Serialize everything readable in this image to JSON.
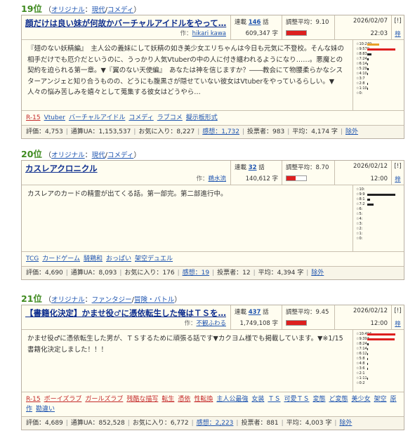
{
  "entries": [
    {
      "rank": "19位",
      "genre_main": "オリジナル",
      "genre_sub": "現代",
      "genre_type": "コメディ",
      "title": "顔だけは良い妹が何故かバーチャルアイドルをやって…",
      "author_label": "作：",
      "author": "hikari kawa",
      "serial_label": "連載",
      "episodes": "146",
      "episodes_unit": "話",
      "chars": "609,347 字",
      "rating_label": "調整平均：9.10",
      "rating_fill": 1.0,
      "date": "2026/02/07",
      "time": "22:03",
      "flag": "[!]",
      "pen": "梓",
      "description": "『翅のない妖精編』　主人公の義妹にして妖精の如き美少女エリちゃんは今日も元気に不登校。そんな妹の相手だけでも厄介だというのに、うっかり人気Vtuberの中の人に付き纏われるようになり……。悪魔との契約を迫られる第一章。▼『翼のない天使編』　あなたは神を信じますか？――教会にて物腰柔らかなシスターアンジェと知り合うものの、どうにも腹黒さが隠せていない彼女はVtuberをやっているらしい。▼人々の悩み苦しみを嬉々として蒐集する彼女はどうやら…",
      "tags": [
        {
          "text": "R-15",
          "class": "r"
        },
        {
          "text": "Vtuber",
          "class": "n"
        },
        {
          "text": "バーチャルアイドル",
          "class": "n"
        },
        {
          "text": "コメディ",
          "class": "n"
        },
        {
          "text": "ラブコメ",
          "class": "n"
        },
        {
          "text": "擬示板形式",
          "class": "n"
        }
      ],
      "graph": [
        {
          "label": "☆10:249",
          "value": 249,
          "color": "#e8a02a"
        },
        {
          "label": "☆9:570",
          "value": 570,
          "color": "#dd1f1f"
        },
        {
          "label": "☆8:83",
          "value": 83,
          "color": "#222"
        },
        {
          "label": "☆7:24",
          "value": 24,
          "color": "#222"
        },
        {
          "label": "☆6:14",
          "value": 14,
          "color": "#222"
        },
        {
          "label": "☆5:29",
          "value": 29,
          "color": "#222"
        },
        {
          "label": "☆4:10",
          "value": 10,
          "color": "#222"
        },
        {
          "label": "☆3:7",
          "value": 7,
          "color": "#222"
        },
        {
          "label": "☆2:8",
          "value": 8,
          "color": "#222"
        },
        {
          "label": "☆1:10",
          "value": 10,
          "color": "#222"
        },
        {
          "label": "☆0:",
          "value": 0,
          "color": "#222"
        }
      ],
      "stats": {
        "rating": "評価：4,753",
        "ua": "通算UA：1,153,537",
        "fav": "お気に入り：8,227",
        "review": "感想：1,732",
        "voters": "投票者：983",
        "avg": "平均：4,174 字",
        "exclude": "除外"
      }
    },
    {
      "rank": "20位",
      "genre_main": "オリジナル",
      "genre_sub": "現代",
      "genre_type": "コメディ",
      "title": "カスレアクロニクル",
      "author_label": "作：",
      "author": "鵜水流",
      "serial_label": "連載",
      "episodes": "32",
      "episodes_unit": "話",
      "chars": "140,612 字",
      "rating_label": "調整平均：8.70",
      "rating_fill": 0.45,
      "date": "2026/02/12",
      "time": "12:00",
      "flag": "[!]",
      "pen": "梓",
      "description": "カスレアのカードの精霊が出てくる話。第一部完。第二部進行中。",
      "tags": [
        {
          "text": "TCG",
          "class": "n"
        },
        {
          "text": "カードゲーム",
          "class": "n"
        },
        {
          "text": "騎鶏和",
          "class": "n"
        },
        {
          "text": "おっぱい",
          "class": "n"
        },
        {
          "text": "架空デュエル",
          "class": "n"
        }
      ],
      "graph": [
        {
          "label": "☆10:",
          "value": 0,
          "color": "#222"
        },
        {
          "label": "☆9:9",
          "value": 9,
          "color": "#222"
        },
        {
          "label": "☆8:1",
          "value": 1,
          "color": "#222"
        },
        {
          "label": "☆7:2",
          "value": 2,
          "color": "#222"
        },
        {
          "label": "☆6:",
          "value": 0,
          "color": "#222"
        },
        {
          "label": "☆5:",
          "value": 0,
          "color": "#222"
        },
        {
          "label": "☆4:",
          "value": 0,
          "color": "#222"
        },
        {
          "label": "☆3:",
          "value": 0,
          "color": "#222"
        },
        {
          "label": "☆2:",
          "value": 0,
          "color": "#222"
        },
        {
          "label": "☆1:",
          "value": 0,
          "color": "#222"
        },
        {
          "label": "☆0:",
          "value": 0,
          "color": "#222"
        }
      ],
      "stats": {
        "rating": "評価：4,690",
        "ua": "通算UA：8,093",
        "fav": "お気に入り：176",
        "review": "感想：19",
        "voters": "投票者：12",
        "avg": "平均：4,394 字",
        "exclude": "除外"
      }
    },
    {
      "rank": "21位",
      "genre_main": "オリジナル",
      "genre_sub": "ファンタジー",
      "genre_type": "冒険・バトル",
      "title": "【書籍化決定】かませ役♂に憑依転生した俺はＴＳを…",
      "author_label": "作：",
      "author": "不観ふわる",
      "serial_label": "連載",
      "episodes": "437",
      "episodes_unit": "話",
      "chars": "1,749,108 字",
      "rating_label": "調整平均：9.45",
      "rating_fill": 1.0,
      "date": "2026/02/12",
      "time": "12:00",
      "flag": "[!]",
      "pen": "梓",
      "description": "かませ役♂に憑依転生した男が、ＴＳするために頑張る話です▼カクヨム様でも掲載しています。▼※1/15 書籍化決定しました！！！",
      "tags": [
        {
          "text": "R-15",
          "class": "r"
        },
        {
          "text": "ボーイズラブ",
          "class": "r"
        },
        {
          "text": "ガールズラブ",
          "class": "r"
        },
        {
          "text": "残酷な描写",
          "class": "r"
        },
        {
          "text": "転生",
          "class": "r"
        },
        {
          "text": "憑依",
          "class": "r"
        },
        {
          "text": "性転換",
          "class": "r"
        },
        {
          "text": "主人公最強",
          "class": "n"
        },
        {
          "text": "女装",
          "class": "n"
        },
        {
          "text": "ＴＳ",
          "class": "n"
        },
        {
          "text": "可愛ＴＳ",
          "class": "n"
        },
        {
          "text": "変態",
          "class": "n"
        },
        {
          "text": "ど変態",
          "class": "n"
        },
        {
          "text": "美少女",
          "class": "n"
        },
        {
          "text": "架空",
          "class": "n"
        },
        {
          "text": "原作",
          "class": "n"
        },
        {
          "text": "勘違い",
          "class": "n"
        }
      ],
      "graph": [
        {
          "label": "☆10:404",
          "value": 404,
          "color": "#dd1f1f"
        },
        {
          "label": "☆9:393",
          "value": 393,
          "color": "#dd1f1f"
        },
        {
          "label": "☆8:24",
          "value": 24,
          "color": "#222"
        },
        {
          "label": "☆7:14",
          "value": 14,
          "color": "#222"
        },
        {
          "label": "☆6:12",
          "value": 12,
          "color": "#222"
        },
        {
          "label": "☆5:8",
          "value": 8,
          "color": "#222"
        },
        {
          "label": "☆4:8",
          "value": 8,
          "color": "#222"
        },
        {
          "label": "☆3:6",
          "value": 6,
          "color": "#222"
        },
        {
          "label": "☆2:1",
          "value": 1,
          "color": "#222"
        },
        {
          "label": "☆1:11",
          "value": 11,
          "color": "#222"
        },
        {
          "label": "☆0:2",
          "value": 2,
          "color": "#222"
        }
      ],
      "stats": {
        "rating": "評価：4,689",
        "ua": "通算UA：852,528",
        "fav": "お気に入り：6,772",
        "review": "感想：2,223",
        "voters": "投票者：881",
        "avg": "平均：4,003 字",
        "exclude": "除外"
      }
    }
  ]
}
